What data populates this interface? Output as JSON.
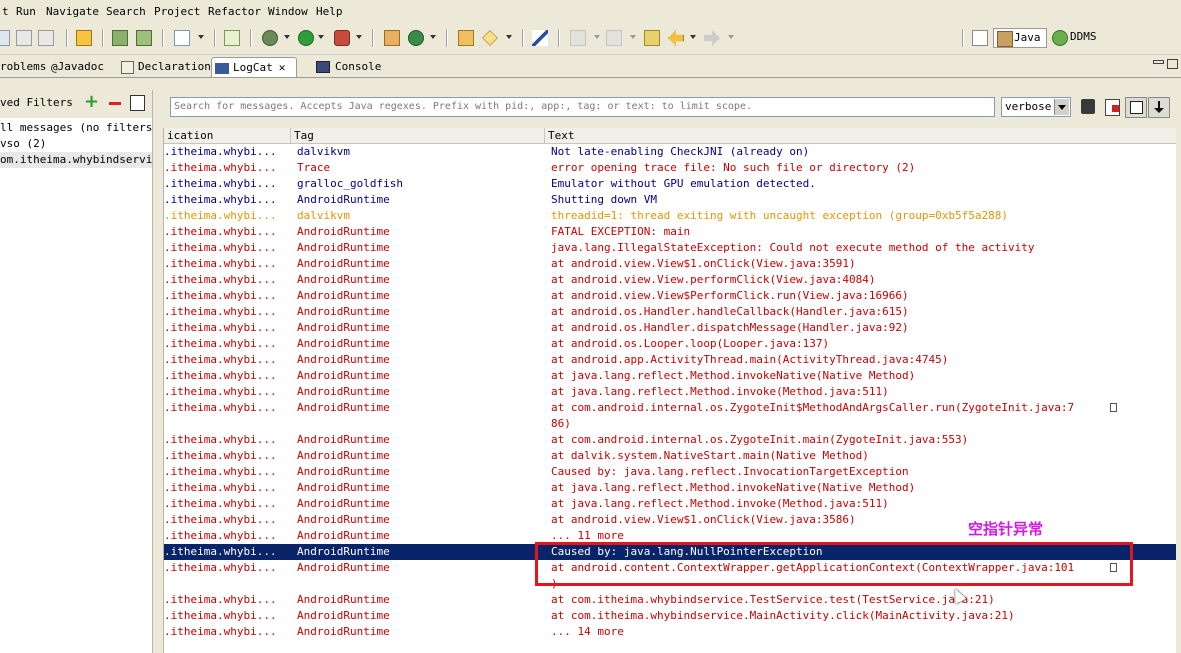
{
  "menu": [
    "t",
    "Run",
    "Navigate",
    "Search",
    "Project",
    "Refactor",
    "Window",
    "Help"
  ],
  "perspectives": {
    "java": "Java",
    "ddms": "DDMS"
  },
  "tabs": [
    {
      "label": "roblems",
      "icon": "problems-icon"
    },
    {
      "label": "Javadoc",
      "icon": "at-icon"
    },
    {
      "label": "Declaration",
      "icon": "declaration-icon"
    },
    {
      "label": "LogCat",
      "icon": "logcat-icon",
      "active": true
    },
    {
      "label": "Console",
      "icon": "console-icon"
    }
  ],
  "filters": {
    "title": "ved Filters",
    "items": [
      "ll messages (no filters)",
      "vso (2)",
      "om.itheima.whybindservice"
    ]
  },
  "search": {
    "placeholder": "Search for messages. Accepts Java regexes. Prefix with pid:, app:, tag: or text: to limit scope."
  },
  "level": "verbose",
  "columns": {
    "application": "ication",
    "tag": "Tag",
    "text": "Text"
  },
  "colors": {
    "info": "#00008b",
    "error": "#cc0000",
    "warn": "#e69500",
    "selected": "#0a246a",
    "annotation_box": "#e3151d",
    "annotation_text": "#d41be6"
  },
  "rows": [
    {
      "app": ".itheima.whybi...",
      "tag": "dalvikvm",
      "text": "Not late-enabling CheckJNI (already on)",
      "level": "info"
    },
    {
      "app": ".itheima.whybi...",
      "tag": "Trace",
      "text": "error opening trace file: No such file or directory (2)",
      "level": "error"
    },
    {
      "app": ".itheima.whybi...",
      "tag": "gralloc_goldfish",
      "text": "Emulator without GPU emulation detected.",
      "level": "info"
    },
    {
      "app": ".itheima.whybi...",
      "tag": "AndroidRuntime",
      "text": "Shutting down VM",
      "level": "info"
    },
    {
      "app": ".itheima.whybi...",
      "tag": "dalvikvm",
      "text": "threadid=1: thread exiting with uncaught exception (group=0xb5f5a288)",
      "level": "warn"
    },
    {
      "app": ".itheima.whybi...",
      "tag": "AndroidRuntime",
      "text": "FATAL EXCEPTION: main",
      "level": "error"
    },
    {
      "app": ".itheima.whybi...",
      "tag": "AndroidRuntime",
      "text": "java.lang.IllegalStateException: Could not execute method of the activity",
      "level": "error"
    },
    {
      "app": ".itheima.whybi...",
      "tag": "AndroidRuntime",
      "text": "at android.view.View$1.onClick(View.java:3591)",
      "level": "error"
    },
    {
      "app": ".itheima.whybi...",
      "tag": "AndroidRuntime",
      "text": "at android.view.View.performClick(View.java:4084)",
      "level": "error"
    },
    {
      "app": ".itheima.whybi...",
      "tag": "AndroidRuntime",
      "text": "at android.view.View$PerformClick.run(View.java:16966)",
      "level": "error"
    },
    {
      "app": ".itheima.whybi...",
      "tag": "AndroidRuntime",
      "text": "at android.os.Handler.handleCallback(Handler.java:615)",
      "level": "error"
    },
    {
      "app": ".itheima.whybi...",
      "tag": "AndroidRuntime",
      "text": "at android.os.Handler.dispatchMessage(Handler.java:92)",
      "level": "error"
    },
    {
      "app": ".itheima.whybi...",
      "tag": "AndroidRuntime",
      "text": "at android.os.Looper.loop(Looper.java:137)",
      "level": "error"
    },
    {
      "app": ".itheima.whybi...",
      "tag": "AndroidRuntime",
      "text": "at android.app.ActivityThread.main(ActivityThread.java:4745)",
      "level": "error"
    },
    {
      "app": ".itheima.whybi...",
      "tag": "AndroidRuntime",
      "text": "at java.lang.reflect.Method.invokeNative(Native Method)",
      "level": "error"
    },
    {
      "app": ".itheima.whybi...",
      "tag": "AndroidRuntime",
      "text": "at java.lang.reflect.Method.invoke(Method.java:511)",
      "level": "error"
    },
    {
      "app": ".itheima.whybi...",
      "tag": "AndroidRuntime",
      "text": "at com.android.internal.os.ZygoteInit$MethodAndArgsCaller.run(ZygoteInit.java:7",
      "level": "error",
      "wrapped": true
    },
    {
      "app": "",
      "tag": "",
      "text": "86)",
      "level": "error"
    },
    {
      "app": ".itheima.whybi...",
      "tag": "AndroidRuntime",
      "text": "at com.android.internal.os.ZygoteInit.main(ZygoteInit.java:553)",
      "level": "error"
    },
    {
      "app": ".itheima.whybi...",
      "tag": "AndroidRuntime",
      "text": "at dalvik.system.NativeStart.main(Native Method)",
      "level": "error"
    },
    {
      "app": ".itheima.whybi...",
      "tag": "AndroidRuntime",
      "text": "Caused by: java.lang.reflect.InvocationTargetException",
      "level": "error"
    },
    {
      "app": ".itheima.whybi...",
      "tag": "AndroidRuntime",
      "text": "at java.lang.reflect.Method.invokeNative(Native Method)",
      "level": "error"
    },
    {
      "app": ".itheima.whybi...",
      "tag": "AndroidRuntime",
      "text": "at java.lang.reflect.Method.invoke(Method.java:511)",
      "level": "error"
    },
    {
      "app": ".itheima.whybi...",
      "tag": "AndroidRuntime",
      "text": "at android.view.View$1.onClick(View.java:3586)",
      "level": "error"
    },
    {
      "app": ".itheima.whybi...",
      "tag": "AndroidRuntime",
      "text": "... 11 more",
      "level": "error"
    },
    {
      "app": ".itheima.whybi...",
      "tag": "AndroidRuntime",
      "text": "Caused by: java.lang.NullPointerException",
      "level": "error",
      "selected": true
    },
    {
      "app": ".itheima.whybi...",
      "tag": "AndroidRuntime",
      "text": "at android.content.ContextWrapper.getApplicationContext(ContextWrapper.java:101",
      "level": "error",
      "wrapped": true
    },
    {
      "app": "",
      "tag": "",
      "text": ")",
      "level": "error"
    },
    {
      "app": ".itheima.whybi...",
      "tag": "AndroidRuntime",
      "text": "at com.itheima.whybindservice.TestService.test(TestService.java:21)",
      "level": "error"
    },
    {
      "app": ".itheima.whybi...",
      "tag": "AndroidRuntime",
      "text": "at com.itheima.whybindservice.MainActivity.click(MainActivity.java:21)",
      "level": "error"
    },
    {
      "app": ".itheima.whybi...",
      "tag": "AndroidRuntime",
      "text": "... 14 more",
      "level": "error"
    }
  ],
  "annotation": "空指针异常"
}
